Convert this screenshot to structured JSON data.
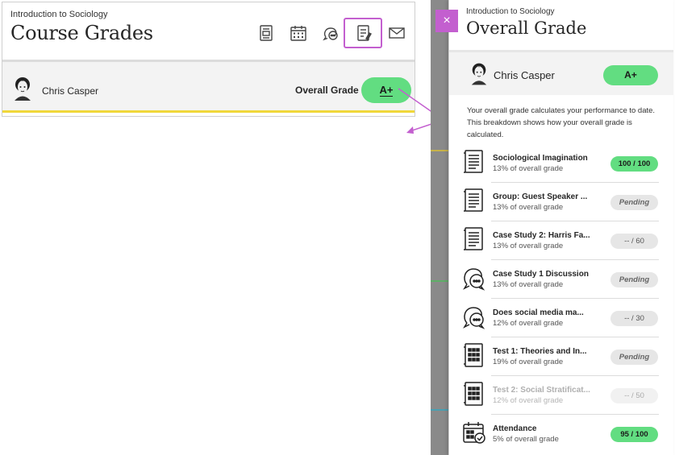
{
  "left": {
    "course": "Introduction to Sociology",
    "title": "Course Grades",
    "student": "Chris Casper",
    "overall_label": "Overall Grade",
    "grade": "A+"
  },
  "panel": {
    "close_icon": "×",
    "course": "Introduction to Sociology",
    "title": "Overall Grade",
    "student": "Chris Casper",
    "grade": "A+",
    "description": "Your overall grade calculates your performance to date. This breakdown shows how your overall grade is calculated.",
    "items": [
      {
        "name": "Sociological Imagination",
        "weight": "13% of overall grade",
        "score": "100 / 100",
        "status": "graded",
        "icon": "document-icon"
      },
      {
        "name": "Group: Guest Speaker ...",
        "weight": "13% of overall grade",
        "score": "Pending",
        "status": "pending",
        "icon": "document-icon"
      },
      {
        "name": "Case Study 2: Harris Fa...",
        "weight": "13% of overall grade",
        "score": "-- / 60",
        "status": "none",
        "icon": "document-icon"
      },
      {
        "name": "Case Study 1 Discussion",
        "weight": "13% of overall grade",
        "score": "Pending",
        "status": "pending",
        "icon": "discussion-icon"
      },
      {
        "name": "Does social media ma...",
        "weight": "12% of overall grade",
        "score": "-- / 30",
        "status": "none",
        "icon": "discussion-icon"
      },
      {
        "name": "Test 1: Theories and In...",
        "weight": "19% of overall grade",
        "score": "Pending",
        "status": "pending",
        "icon": "test-icon"
      },
      {
        "name": "Test 2: Social Stratificat...",
        "weight": "12% of overall grade",
        "score": "-- / 50",
        "status": "faded",
        "icon": "test-icon"
      },
      {
        "name": "Attendance",
        "weight": "5% of overall grade",
        "score": "95 / 100",
        "status": "graded",
        "icon": "attendance-icon"
      }
    ]
  },
  "colors": {
    "accent": "#c35fcf",
    "grade_green": "#62dd81",
    "progress_yellow": "#f0d73a"
  }
}
